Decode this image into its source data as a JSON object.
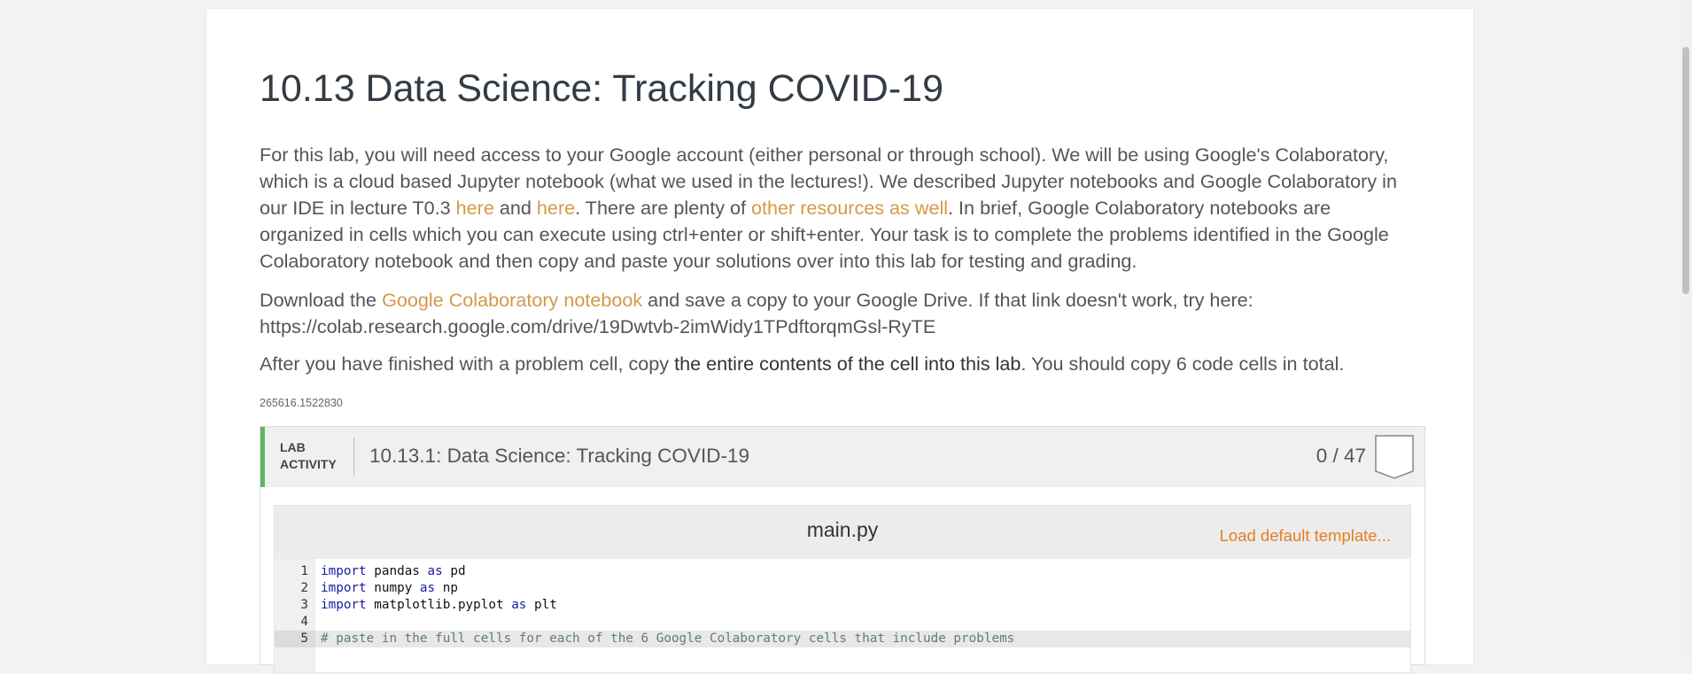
{
  "page": {
    "title": "10.13 Data Science: Tracking COVID-19",
    "intro": {
      "t1": "For this lab, you will need access to your Google account (either personal or through school). We will be using Google's Colaboratory, which is a cloud based Jupyter notebook (what we used in the lectures!). We described Jupyter notebooks and Google Colaboratory in our IDE in lecture T0.3 ",
      "link1": "here",
      "t2": " and ",
      "link2": "here",
      "t3": ". There are plenty of ",
      "link3": "other resources as well",
      "t4": ". In brief, Google Colaboratory notebooks are organized in cells which you can execute using ctrl+enter or shift+enter. Your task is to complete the problems identified in the Google Colaboratory notebook and then copy and paste your solutions over into this lab for testing and grading."
    },
    "download": {
      "t1": "Download the ",
      "link": "Google Colaboratory notebook",
      "t2": " and save a copy to your Google Drive. If that link doesn't work, try here: https://colab.research.google.com/drive/19Dwtvb-2imWidy1TPdftorqmGsl-RyTE"
    },
    "after": {
      "t1": "After you have finished with a problem cell, copy ",
      "bold": "the entire contents of the cell into this lab",
      "t2": ". You should copy 6 code cells in total."
    },
    "lab_id": "265616.1522830"
  },
  "lab": {
    "tag_line1": "LAB",
    "tag_line2": "ACTIVITY",
    "title": "10.13.1: Data Science: Tracking COVID-19",
    "score": "0 / 47",
    "accent_color": "#5cb85c"
  },
  "editor": {
    "file_name": "main.py",
    "load_template": "Load default template...",
    "lines": [
      {
        "n": "1",
        "kw1": "import",
        "a": " pandas ",
        "kw2": "as",
        "b": " pd"
      },
      {
        "n": "2",
        "kw1": "import",
        "a": " numpy ",
        "kw2": "as",
        "b": " np"
      },
      {
        "n": "3",
        "kw1": "import",
        "a": " matplotlib.pyplot ",
        "kw2": "as",
        "b": " plt"
      },
      {
        "n": "4"
      },
      {
        "n": "5",
        "comment": "# paste in the full cells for each of the 6 Google Colaboratory cells that include problems"
      }
    ]
  }
}
